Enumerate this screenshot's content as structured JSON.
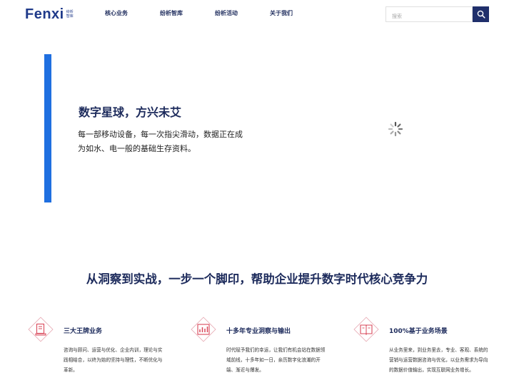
{
  "header": {
    "logo_text": "Fenxi",
    "logo_sub": "纷析 智库",
    "nav": [
      "核心业务",
      "纷析智库",
      "纷析活动",
      "关于我们"
    ],
    "search_placeholder": "搜索"
  },
  "hero": {
    "title": "数字星球，方兴未艾",
    "text": "每一部移动设备，每一次指尖滑动，数据正在成为如水、电一般的基础生存资料。"
  },
  "tagline": "从洞察到实战，一步一个脚印，帮助企业提升数字时代核心竞争力",
  "features": [
    {
      "icon": "document-icon",
      "title": "三大王牌业务",
      "text": "咨询与顾问、运营与优化、企业内训，理论与实践相结合，以终为始的坚持与理性，不断优化与革新。"
    },
    {
      "icon": "chart-icon",
      "title": "十多年专业洞察与输出",
      "text": "时代赋予我们的幸运，让我们有机会站在数据领域前线，十多年如一日，亲历数字化浪潮的开端、渐近与爆发。"
    },
    {
      "icon": "book-icon",
      "title": "100%基于业务场景",
      "text": "从业务里来，到业务里去，专业、客观、系统的营销与运营数据咨询与优化，以业务需求为导向的数据价值输出，实现互联网业务增长。"
    }
  ],
  "colors": {
    "brand": "#1f3a8a",
    "navy": "#1d2b5c",
    "accent_bar": "#1f6fe0",
    "icon_red": "#d9475a",
    "search_button": "#1f2f6b"
  }
}
